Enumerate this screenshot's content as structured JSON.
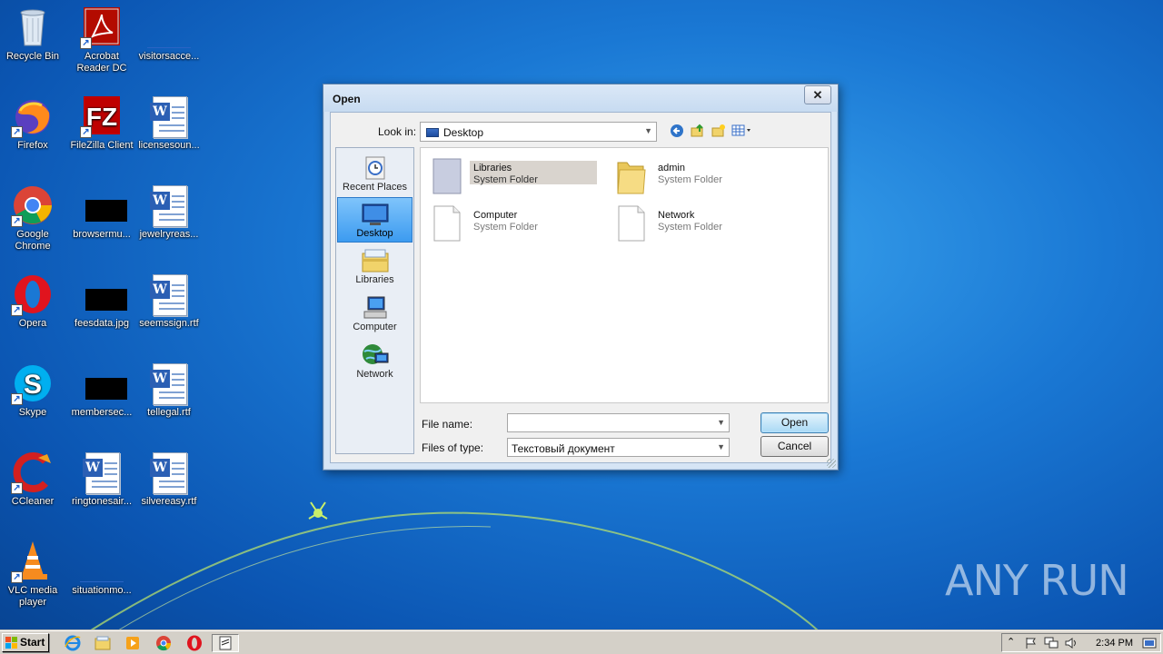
{
  "desktop": {
    "icons": [
      {
        "label": "Recycle Bin"
      },
      {
        "label": "Acrobat\nReader DC"
      },
      {
        "label": "visitorsacce..."
      },
      {
        "label": "Firefox"
      },
      {
        "label": "FileZilla Client"
      },
      {
        "label": "licensesoun..."
      },
      {
        "label": "Google\nChrome"
      },
      {
        "label": "browsermu..."
      },
      {
        "label": "jewelryreas..."
      },
      {
        "label": "Opera"
      },
      {
        "label": "feesdata.jpg"
      },
      {
        "label": "seemssign.rtf"
      },
      {
        "label": "Skype"
      },
      {
        "label": "membersec..."
      },
      {
        "label": "tellegal.rtf"
      },
      {
        "label": "CCleaner"
      },
      {
        "label": "ringtonesair..."
      },
      {
        "label": "silvereasy.rtf"
      },
      {
        "label": "VLC media\nplayer"
      },
      {
        "label": "situationmo..."
      }
    ]
  },
  "dialog": {
    "title": "Open",
    "close_glyph": "✕",
    "look_in_label": "Look in:",
    "look_in_value": "Desktop",
    "places": [
      {
        "label": "Recent Places"
      },
      {
        "label": "Desktop"
      },
      {
        "label": "Libraries"
      },
      {
        "label": "Computer"
      },
      {
        "label": "Network"
      }
    ],
    "files": [
      {
        "name": "Libraries",
        "type": "System Folder"
      },
      {
        "name": "admin",
        "type": "System Folder"
      },
      {
        "name": "Computer",
        "type": "System Folder"
      },
      {
        "name": "Network",
        "type": "System Folder"
      }
    ],
    "file_name_label": "File name:",
    "file_name_value": "",
    "files_of_type_label": "Files of type:",
    "files_of_type_value": "Текстовый документ",
    "open_button": "Open",
    "cancel_button": "Cancel"
  },
  "taskbar": {
    "start_label": "Start",
    "clock": "2:34 PM"
  },
  "watermark": "ANY RUN"
}
